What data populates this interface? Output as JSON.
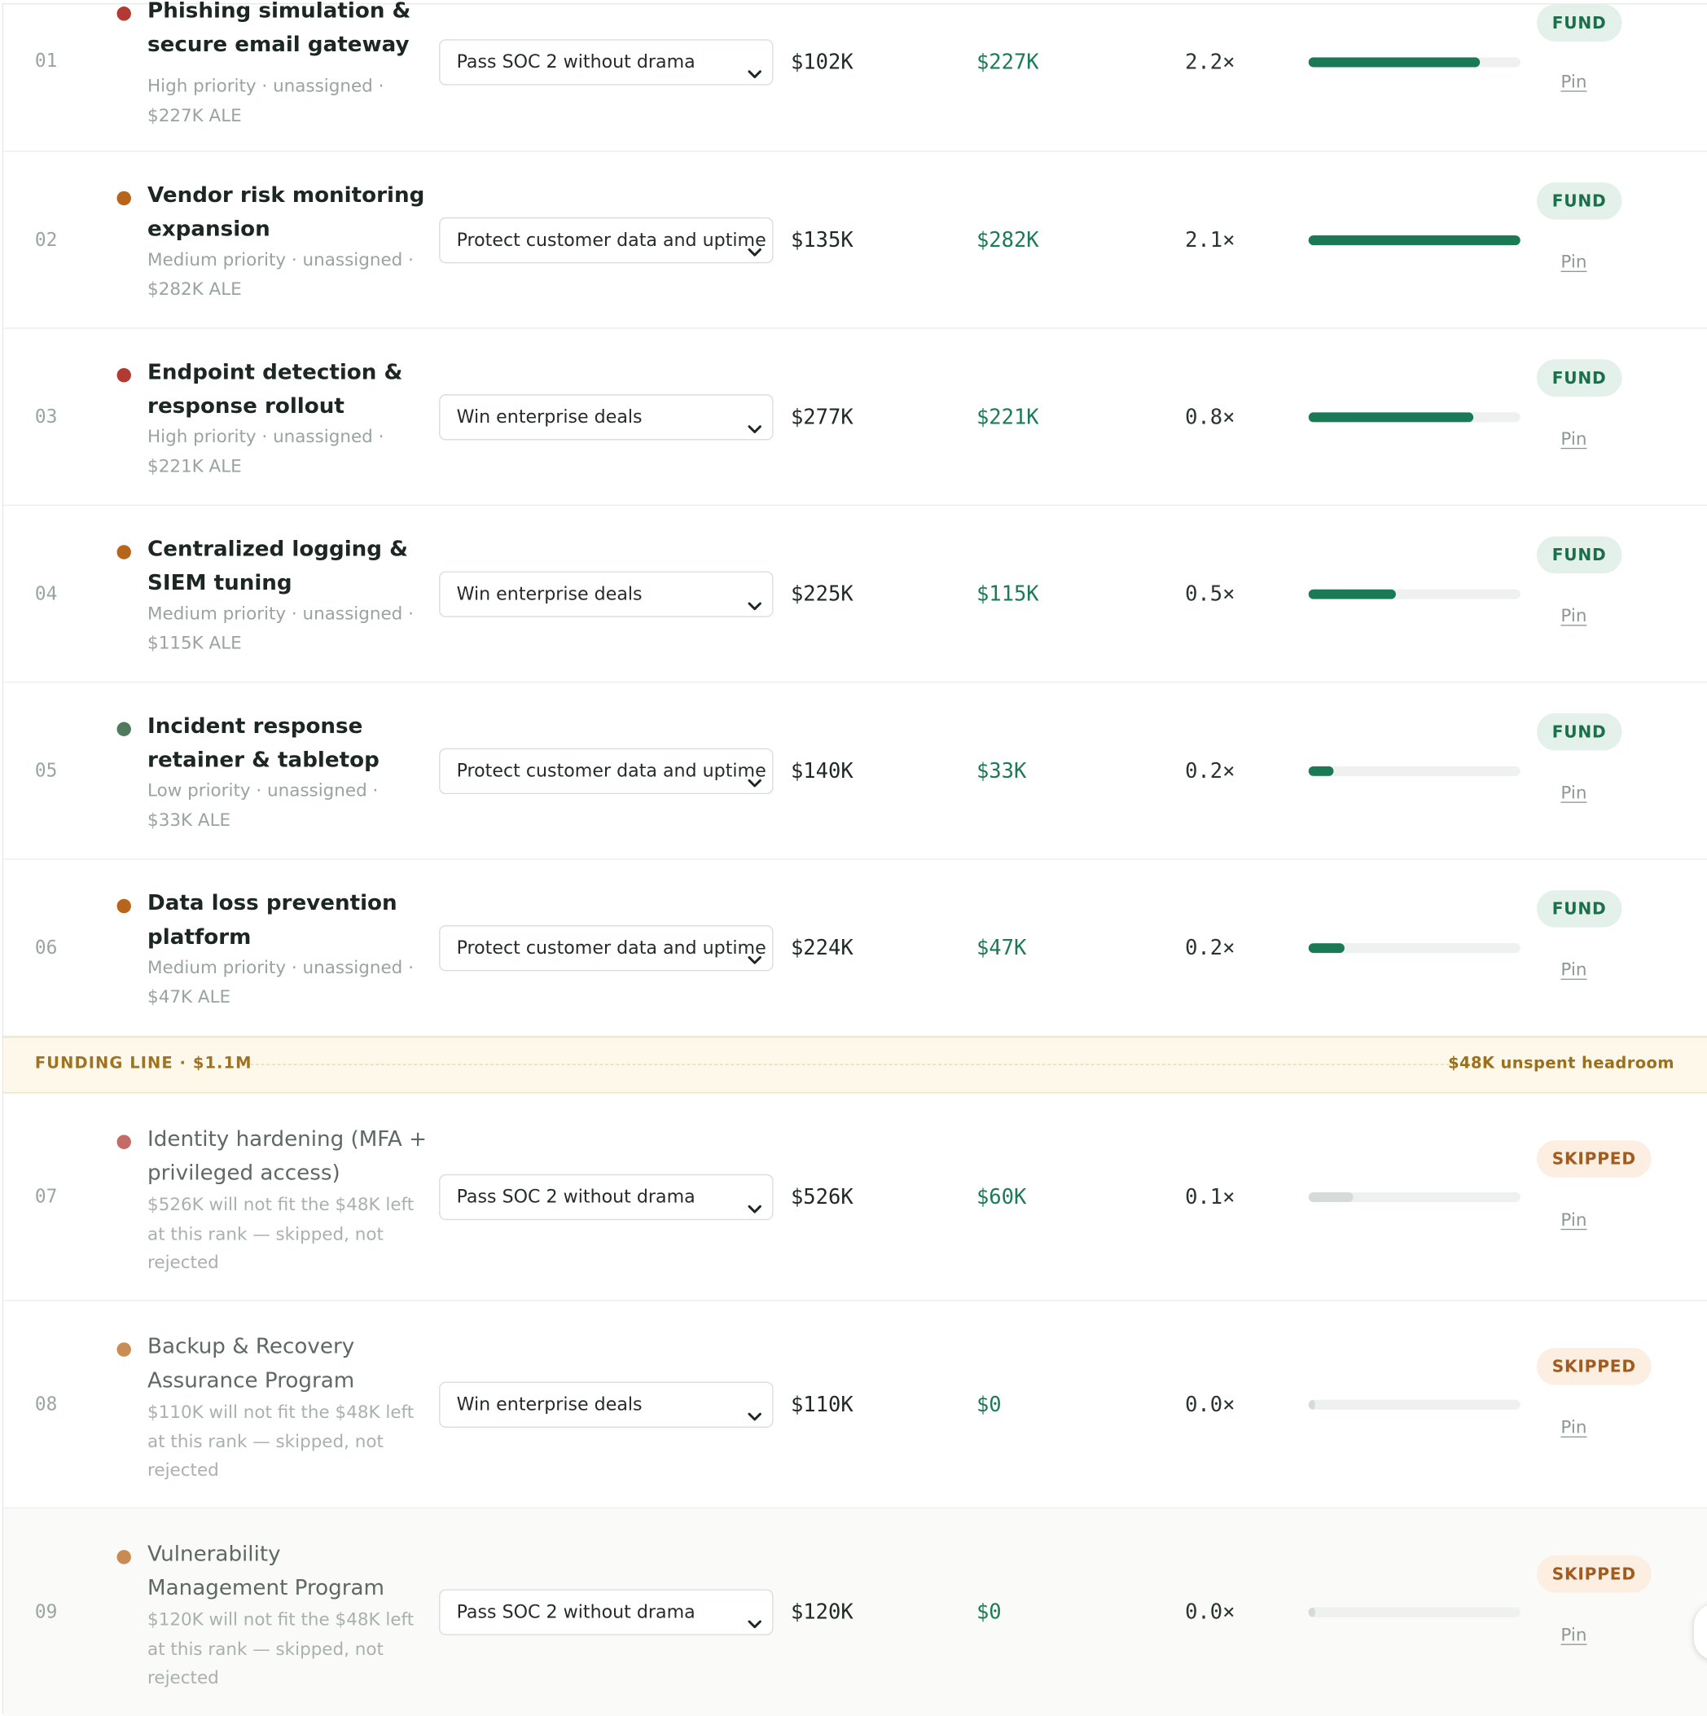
{
  "colors": {
    "high_priority": "#b23a32",
    "medium_priority": "#b8651c",
    "low_priority": "#4f7a5e",
    "fund_bar": "#1a7a55",
    "skip_bar": "#d5dbd8",
    "fund_badge_text": "#1a6f4c",
    "skip_badge_text": "#a35a1d",
    "value_text": "#1d7a57"
  },
  "funding_line": {
    "label": "FUNDING LINE · $1.1M",
    "headroom": "$48K unspent headroom"
  },
  "rows_above": [
    {
      "rank": "01",
      "priority": "high",
      "name": "Phishing simulation & secure email gateway",
      "meta": "High priority · unassigned · $227K ALE",
      "objective": "Pass SOC 2 without drama",
      "cost": "$102K",
      "value": "$227K",
      "roi": "2.2×",
      "bar_fraction": 0.81,
      "status": "FUND",
      "action": "Pin"
    },
    {
      "rank": "02",
      "priority": "medium",
      "name": "Vendor risk monitoring expansion",
      "meta": "Medium priority · unassigned · $282K ALE",
      "objective": "Protect customer data and uptime",
      "cost": "$135K",
      "value": "$282K",
      "roi": "2.1×",
      "bar_fraction": 1.0,
      "status": "FUND",
      "action": "Pin"
    },
    {
      "rank": "03",
      "priority": "high",
      "name": "Endpoint detection & response rollout",
      "meta": "High priority · unassigned · $221K ALE",
      "objective": "Win enterprise deals",
      "cost": "$277K",
      "value": "$221K",
      "roi": "0.8×",
      "bar_fraction": 0.78,
      "status": "FUND",
      "action": "Pin"
    },
    {
      "rank": "04",
      "priority": "medium",
      "name": "Centralized logging & SIEM tuning",
      "meta": "Medium priority · unassigned · $115K ALE",
      "objective": "Win enterprise deals",
      "cost": "$225K",
      "value": "$115K",
      "roi": "0.5×",
      "bar_fraction": 0.41,
      "status": "FUND",
      "action": "Pin"
    },
    {
      "rank": "05",
      "priority": "low",
      "name": "Incident response retainer & tabletop",
      "meta": "Low priority · unassigned · $33K ALE",
      "objective": "Protect customer data and uptime",
      "cost": "$140K",
      "value": "$33K",
      "roi": "0.2×",
      "bar_fraction": 0.12,
      "status": "FUND",
      "action": "Pin"
    },
    {
      "rank": "06",
      "priority": "medium",
      "name": "Data loss prevention platform",
      "meta": "Medium priority · unassigned · $47K ALE",
      "objective": "Protect customer data and uptime",
      "cost": "$224K",
      "value": "$47K",
      "roi": "0.2×",
      "bar_fraction": 0.17,
      "status": "FUND",
      "action": "Pin"
    }
  ],
  "rows_below": [
    {
      "rank": "07",
      "priority": "high",
      "name": "Identity hardening (MFA + privileged access)",
      "meta": "$526K will not fit the $48K left at this rank — skipped, not rejected",
      "objective": "Pass SOC 2 without drama",
      "cost": "$526K",
      "value": "$60K",
      "roi": "0.1×",
      "bar_fraction": 0.21,
      "status": "SKIPPED",
      "action": "Pin"
    },
    {
      "rank": "08",
      "priority": "medium",
      "name": "Backup & Recovery Assurance Program",
      "meta": "$110K will not fit the $48K left at this rank — skipped, not rejected",
      "objective": "Win enterprise deals",
      "cost": "$110K",
      "value": "$0",
      "roi": "0.0×",
      "bar_fraction": 0.03,
      "status": "SKIPPED",
      "action": "Pin"
    },
    {
      "rank": "09",
      "priority": "medium",
      "name": "Vulnerability Management Program",
      "meta": "$120K will not fit the $48K left at this rank — skipped, not rejected",
      "objective": "Pass SOC 2 without drama",
      "cost": "$120K",
      "value": "$0",
      "roi": "0.0×",
      "bar_fraction": 0.03,
      "status": "SKIPPED",
      "action": "Pin"
    }
  ]
}
